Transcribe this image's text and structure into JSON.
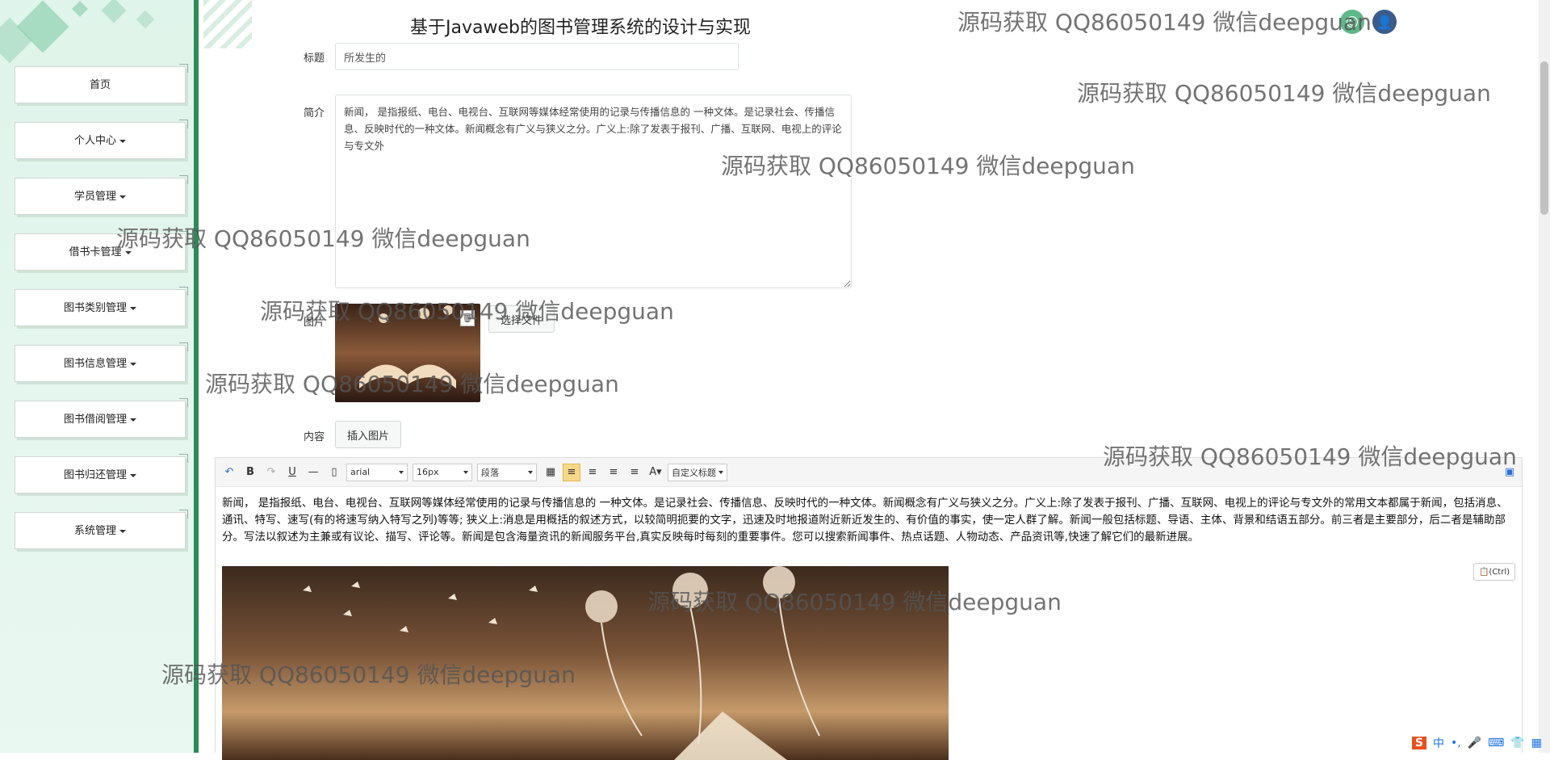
{
  "page_title": "基于Javaweb的图书管理系统的设计与实现",
  "sidebar": {
    "items": [
      {
        "label": "首页",
        "has_caret": false
      },
      {
        "label": "个人中心",
        "has_caret": true
      },
      {
        "label": "学员管理",
        "has_caret": true
      },
      {
        "label": "借书卡管理",
        "has_caret": true
      },
      {
        "label": "图书类别管理",
        "has_caret": true
      },
      {
        "label": "图书信息管理",
        "has_caret": true
      },
      {
        "label": "图书借阅管理",
        "has_caret": true
      },
      {
        "label": "图书归还管理",
        "has_caret": true
      },
      {
        "label": "系统管理",
        "has_caret": true
      }
    ]
  },
  "form": {
    "title_label": "标题",
    "title_value": "所发生的",
    "summary_label": "简介",
    "summary_value": "新闻， 是指报纸、电台、电视台、互联网等媒体经常使用的记录与传播信息的 一种文体。是记录社会、传播信息、反映时代的一种文体。新闻概念有广义与狭义之分。广义上:除了发表于报刊、广播、互联网、电视上的评论与专文外",
    "image_label": "图片",
    "choose_file_label": "选择文件",
    "content_label": "内容",
    "insert_image_label": "插入图片"
  },
  "editor": {
    "font_family": "arial",
    "font_size": "16px",
    "paragraph": "段落",
    "custom_heading": "自定义标题",
    "paste_label": "(Ctrl)",
    "body_text": "新闻， 是指报纸、电台、电视台、互联网等媒体经常使用的记录与传播信息的 一种文体。是记录社会、传播信息、反映时代的一种文体。新闻概念有广义与狭义之分。广义上:除了发表于报刊、广播、互联网、电视上的评论与专文外的常用文本都属于新闻，包括消息、通讯、特写、速写(有的将速写纳入特写之列)等等; 狭义上:消息是用概括的叙述方式，以较简明扼要的文字，迅速及时地报道附近新近发生的、有价值的事实，使一定人群了解。新闻一般包括标题、导语、主体、背景和结语五部分。前三者是主要部分，后二者是辅助部分。写法以叙述为主兼或有议论、描写、评论等。新闻是包含海量资讯的新闻服务平台,真实反映每时每刻的重要事件。您可以搜索新闻事件、热点话题、人物动态、产品资讯等,快速了解它们的最新进展。"
  },
  "watermark_text": "源码获取 QQ86050149 微信deepguan",
  "colors": {
    "sidebar_border": "#2e8b57",
    "sidebar_bg": "#dff4ea",
    "avatar_1": "#5fb88a",
    "avatar_2": "#3b5b8c"
  }
}
